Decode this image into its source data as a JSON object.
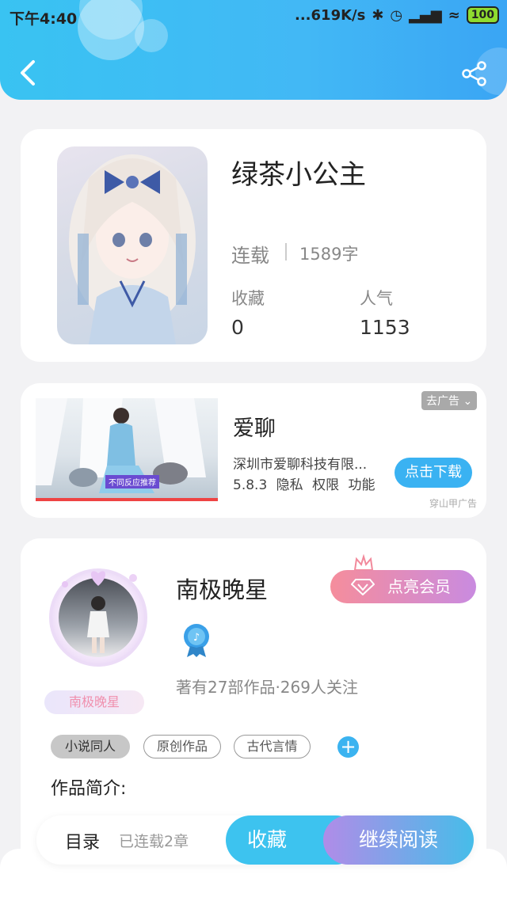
{
  "status_bar": {
    "time": "下午4:40",
    "network_speed": "...619K/s",
    "battery": "100"
  },
  "header": {
    "back_icon": "chevron-left-icon",
    "share_icon": "share-icon"
  },
  "book": {
    "title": "绿茶小公主",
    "status": "连载",
    "word_count": "1589字",
    "favorites_label": "收藏",
    "favorites_value": "0",
    "popularity_label": "人气",
    "popularity_value": "1153"
  },
  "ad": {
    "close_label": "去广告",
    "image_caption": "不同反应推荐",
    "title": "爱聊",
    "description": "深圳市爱聊科技有限...",
    "meta": "5.8.3 隐私 权限 功能",
    "download_label": "点击下载",
    "source": "穿山甲广告"
  },
  "author": {
    "name": "南极晚星",
    "badge_name": "南极晚星",
    "vip_label": "点亮会员",
    "stats": "著有27部作品·269人关注",
    "tags": [
      "小说同人",
      "原创作品",
      "古代言情"
    ],
    "add_tag": "+",
    "intro_label": "作品简介:"
  },
  "bottom_bar": {
    "toc_label": "目录",
    "chapters_label": "已连载2章",
    "favorite_label": "收藏",
    "read_label": "继续阅读"
  },
  "colors": {
    "accent": "#3ab2f2",
    "vip_start": "#f58d9c",
    "vip_end": "#c98be0"
  }
}
